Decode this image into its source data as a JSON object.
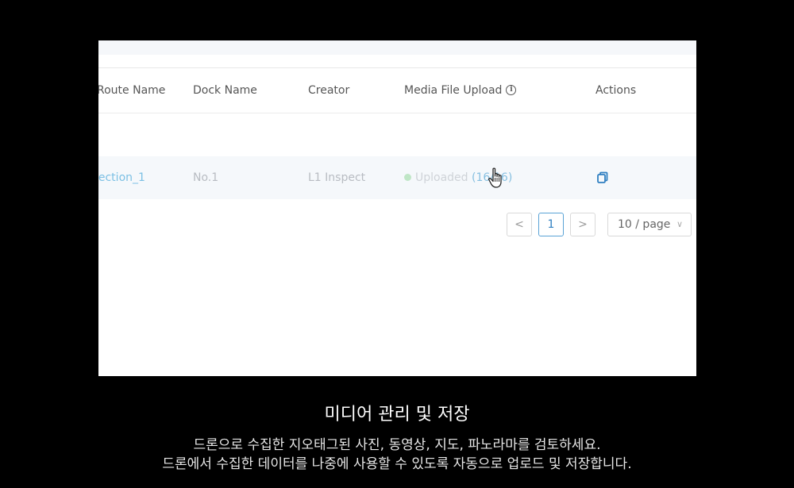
{
  "table": {
    "columns": {
      "route_name": "Route Name",
      "dock_name": "Dock Name",
      "creator": "Creator",
      "media_upload": "Media File Upload",
      "actions": "Actions"
    },
    "rows": [
      {
        "route_name": "nection_1",
        "dock_name": "No.1",
        "creator": "L1 Inspect",
        "status": "Uploaded",
        "count": "(16/16)"
      }
    ],
    "icons": {
      "info": "info-icon",
      "copy": "copy-icon",
      "cursor": "hand-pointer-icon"
    }
  },
  "pagination": {
    "prev": "<",
    "current_page": "1",
    "next": ">",
    "page_size": "10 / page"
  },
  "caption": {
    "title": "미디어 관리 및 저장",
    "line1": "드론으로 수집한 지오태그된 사진, 동영상, 지도, 파노라마를 검토하세요.",
    "line2": "드론에서 수집한 데이터를 나중에 사용할 수 있도록 자동으로 업로드 및 저장합니다."
  },
  "colors": {
    "link": "#7cc0e4",
    "accent": "#2f7fc1",
    "status_dot": "#bfe6c6"
  }
}
